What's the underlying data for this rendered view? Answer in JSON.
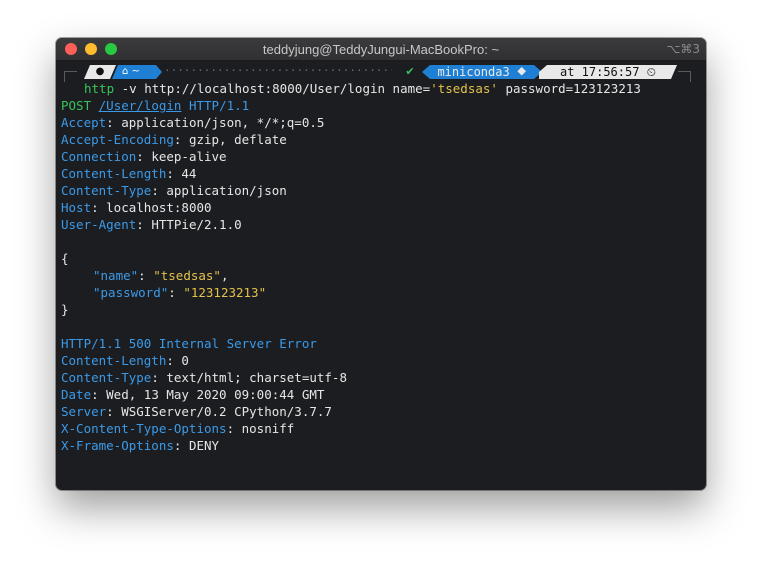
{
  "window": {
    "title": "teddyjung@TeddyJungui-MacBookPro: ~",
    "shortcut": "⌥⌘3"
  },
  "prompt": {
    "apple_icon": "apple-icon",
    "home_label": "⌂ ~",
    "dots": "·································································",
    "status": "✔",
    "env": "miniconda3 ⯁",
    "time": "at 17:56:57 ⏲"
  },
  "command": {
    "prog": "http",
    "args_1": " -v http://localhost:8000/User/login name=",
    "name_value": "'tsedsas'",
    "args_2": " password=123123213"
  },
  "request": {
    "method": "POST",
    "path": "/User/login",
    "proto": "HTTP",
    "version": "/1.1",
    "headers": [
      {
        "key": "Accept",
        "value": ": application/json, */*;q=0.5"
      },
      {
        "key": "Accept-Encoding",
        "value": ": gzip, deflate"
      },
      {
        "key": "Connection",
        "value": ": keep-alive"
      },
      {
        "key": "Content-Length",
        "value": ": 44"
      },
      {
        "key": "Content-Type",
        "value": ": application/json"
      },
      {
        "key": "Host",
        "value": ": localhost:8000"
      },
      {
        "key": "User-Agent",
        "value": ": HTTPie/2.1.0"
      }
    ],
    "body_open": "{",
    "body": [
      {
        "key": "\"name\"",
        "value": "\"tsedsas\"",
        "trail": ","
      },
      {
        "key": "\"password\"",
        "value": "\"123123213\"",
        "trail": ""
      }
    ],
    "body_close": "}"
  },
  "response": {
    "proto": "HTTP",
    "status": "/1.1 500 Internal Server Error",
    "headers": [
      {
        "key": "Content-Length",
        "value": ": 0"
      },
      {
        "key": "Content-Type",
        "value": ": text/html; charset=utf-8"
      },
      {
        "key": "Date",
        "value": ": Wed, 13 May 2020 09:00:44 GMT"
      },
      {
        "key": "Server",
        "value": ": WSGIServer/0.2 CPython/3.7.7"
      },
      {
        "key": "X-Content-Type-Options",
        "value": ": nosniff"
      },
      {
        "key": "X-Frame-Options",
        "value": ": DENY"
      }
    ]
  },
  "colors": {
    "key_blue": "#3b9ae8",
    "string_yellow": "#e3c24b",
    "text": "#e6e6e6",
    "ok_green": "#39c45a",
    "terminal_bg": "#1c1d21"
  }
}
